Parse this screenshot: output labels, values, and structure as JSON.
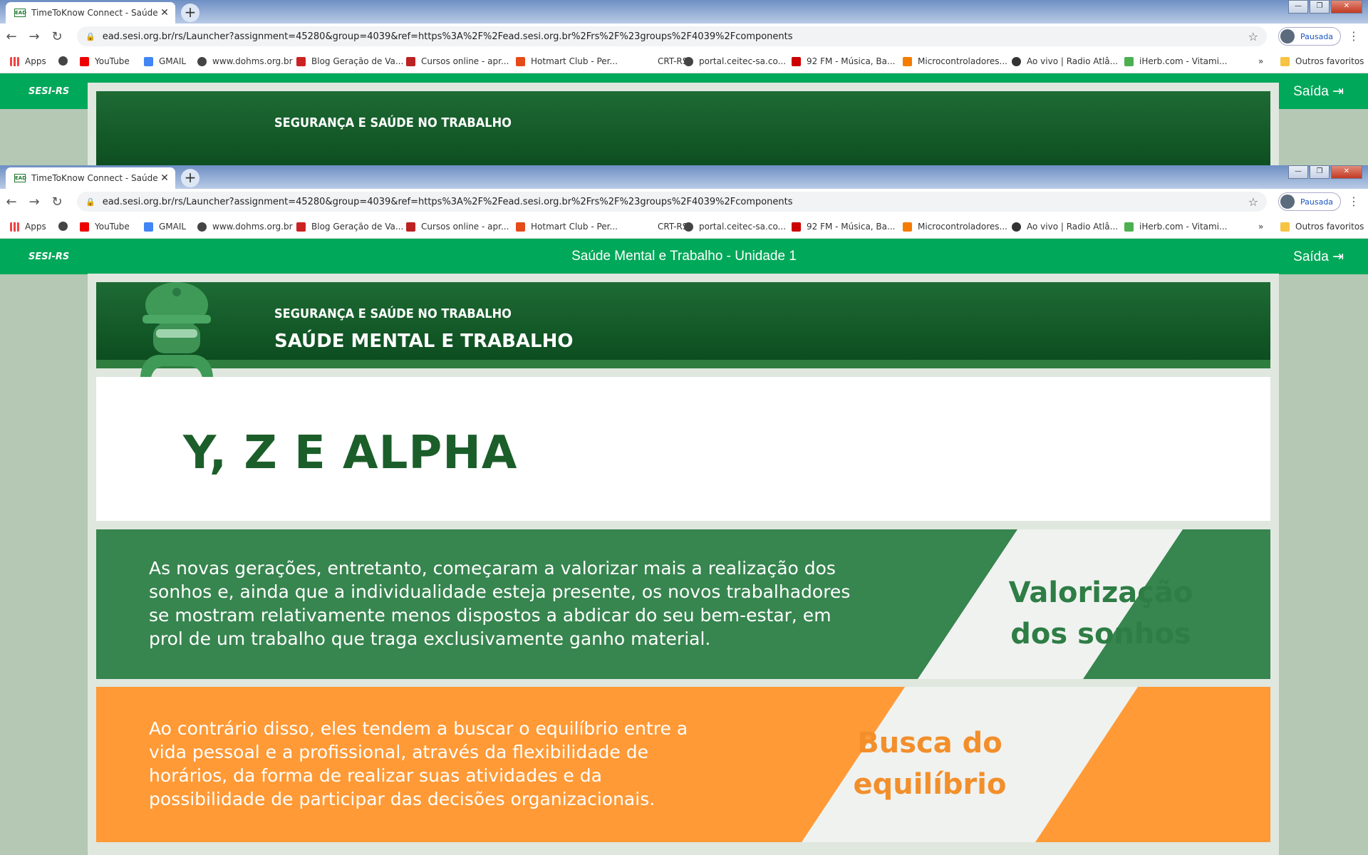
{
  "browser": {
    "tab_title": "TimeToKnow Connect - Saúde M",
    "tab_favicon_text": "EAD",
    "new_tab": "+",
    "url": "ead.sesi.org.br/rs/Launcher?assignment=45280&group=4039&ref=https%3A%2F%2Fead.sesi.org.br%2Frs%2F%23groups%2F4039%2Fcomponents",
    "profile": "Pausada",
    "bookmarks": [
      {
        "label": "Apps",
        "icon": "apps-grid-icon"
      },
      {
        "label": "",
        "icon": "globe-icon"
      },
      {
        "label": "YouTube",
        "icon": "youtube-icon"
      },
      {
        "label": "GMAIL",
        "icon": "google-icon"
      },
      {
        "label": "www.dohms.org.br",
        "icon": "globe-icon"
      },
      {
        "label": "Blog Geração de Va...",
        "icon": "club-icon"
      },
      {
        "label": "Cursos online - apr...",
        "icon": "udemy-icon"
      },
      {
        "label": "Hotmart Club - Per...",
        "icon": "flame-icon"
      },
      {
        "label": "CRT-RS",
        "icon": "page-icon"
      },
      {
        "label": "portal.ceitec-sa.co...",
        "icon": "globe-icon"
      },
      {
        "label": "92 FM - Música, Ba...",
        "icon": "radio-icon"
      },
      {
        "label": "Microcontroladores...",
        "icon": "blogger-icon"
      },
      {
        "label": "Ao vivo | Radio Atlâ...",
        "icon": "radio-live-icon"
      },
      {
        "label": "iHerb.com - Vitami...",
        "icon": "leaf-icon"
      }
    ],
    "bookmarks_overflow": "»",
    "other_bookmarks": "Outros favoritos"
  },
  "site": {
    "logo": "SESI-RS",
    "course_title": "Saúde Mental e Trabalho - Unidade 1",
    "exit_label": "Saída"
  },
  "lesson": {
    "kicker": "SEGURANÇA E SAÚDE NO TRABALHO",
    "heading": "SAÚDE MENTAL E TRABALHO",
    "title": "Y, Z E ALPHA",
    "panels": [
      {
        "text": "As novas gerações, entretanto, começaram a valorizar mais a realização dos sonhos e, ainda que a individualidade esteja presente, os novos trabalhadores se mostram relativamente menos dispostos a abdicar do seu bem-estar, em prol de um trabalho que traga exclusivamente ganho material.",
        "label_line1": "Valorização",
        "label_line2": "dos sonhos",
        "color": "#37854f"
      },
      {
        "text": "Ao contrário disso, eles tendem a buscar o equilíbrio entre a vida pessoal e a profissional, através da flexibilidade de horários, da forma de realizar suas atividades e da possibilidade de participar das decisões organizacionais.",
        "label_line1": "Busca do",
        "label_line2": "equilíbrio",
        "color": "#ff9a36"
      }
    ]
  }
}
